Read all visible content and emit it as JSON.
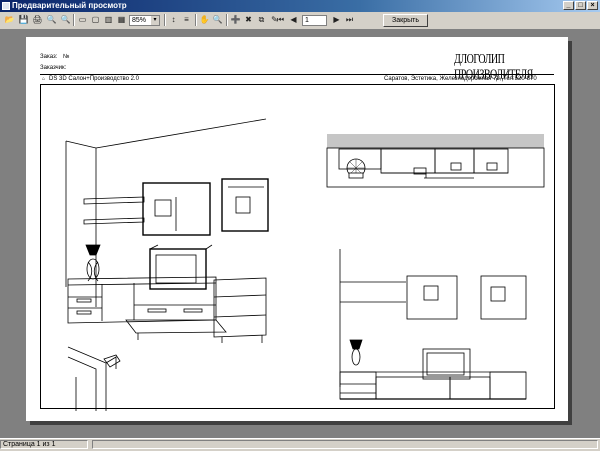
{
  "window": {
    "title": "Предварительный просмотр",
    "minimize_glyph": "_",
    "maximize_glyph": "□",
    "close_glyph": "×"
  },
  "toolbar": {
    "zoom_value": "85%",
    "zoom_dropdown_glyph": "▾",
    "page_number": "1",
    "close_label": "Закрыть",
    "icons": {
      "open": "📂",
      "save": "💾",
      "print": "🖨",
      "find": "🔍",
      "page_width": "▭",
      "whole_page": "▢",
      "two_pages": "▥",
      "four_pages": "▦",
      "pointer": "↕",
      "thumbs": "≡",
      "hand": "✋",
      "magnifier": "🔍",
      "add": "➕",
      "delete": "✖",
      "copy": "⧉",
      "edit": "✎",
      "first": "⏮",
      "prev": "◀",
      "next": "▶",
      "last": "⏭"
    }
  },
  "report": {
    "order_label": "Заказ:",
    "order_no_label": "№",
    "customer_label": "Заказчик:",
    "brand_title": "ДЛОГОЛИП ПРОИЗВОДИТЕЛЯ",
    "software": "DS 3D Салон+Производство 2.0",
    "address": "Саратов, Эстетика, Железнодорожная 72, Тел:520-870"
  },
  "status": {
    "page_info": "Страница 1 из 1"
  },
  "colors": {
    "titlebar_start": "#0a246a",
    "titlebar_end": "#a6caf0",
    "chrome": "#d4d0c8",
    "workspace": "#808080"
  }
}
